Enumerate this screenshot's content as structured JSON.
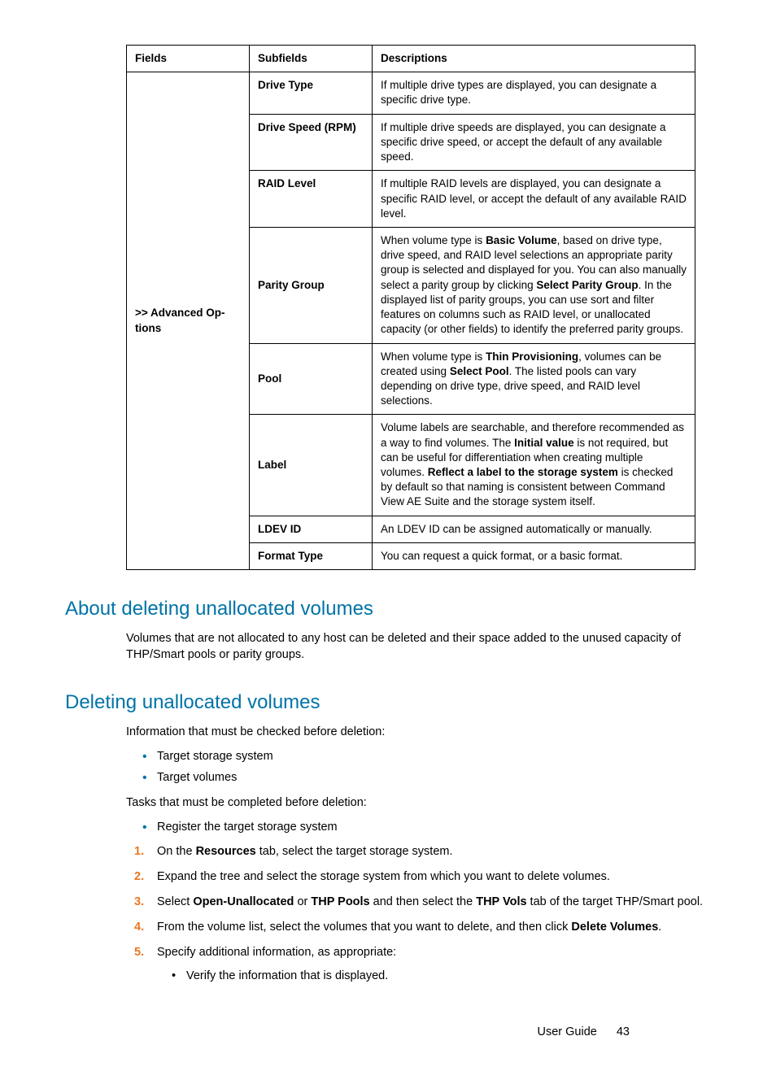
{
  "table": {
    "headers": {
      "c1": "Fields",
      "c2": "Subfields",
      "c3": "Descriptions"
    },
    "fieldLabel": ">> Advanced Op­tions",
    "rows": [
      {
        "sub": "Drive Type",
        "desc": "If multiple drive types are displayed, you can designate a specific drive type."
      },
      {
        "sub": "Drive Speed (RPM)",
        "desc": "If multiple drive speeds are displayed, you can designate a specific drive speed, or accept the default of any available speed."
      },
      {
        "sub": "RAID Level",
        "desc": "If multiple RAID levels are displayed, you can designate a specific RAID level, or accept the default of any available RAID level."
      },
      {
        "sub": "Parity Group",
        "desc_parts": {
          "a": "When volume type is ",
          "b": "Basic Volume",
          "c": ", based on drive type, drive speed, and RAID level selections an appropriate parity group is selected and displayed for you. You can also manually select a parity group by clicking ",
          "d": "Select Parity Group",
          "e": ". In the displayed list of parity groups, you can use sort and filter features on columns such as RAID level, or unallocated capacity (or other fields) to identify the preferred parity groups."
        }
      },
      {
        "sub": "Pool",
        "desc_parts": {
          "a": "When volume type is ",
          "b": "Thin Provisioning",
          "c": ", volumes can be created using ",
          "d": "Select Pool",
          "e": ". The listed pools can vary depending on drive type, drive speed, and RAID level selections."
        }
      },
      {
        "sub": "Label",
        "desc_parts": {
          "a": "Volume labels are searchable, and therefore recommended as a way to find volumes. The ",
          "b": "Initial value",
          "c": " is not required, but can be useful for differentiation when creating multiple volumes. ",
          "d": "Reflect a label to the storage system",
          "e": " is checked by default so that naming is consistent between Command View AE Suite and the storage system itself."
        }
      },
      {
        "sub": "LDEV ID",
        "desc": "An LDEV ID can be assigned automatically or manually."
      },
      {
        "sub": "Format Type",
        "desc": "You can request a quick format, or a basic format."
      }
    ]
  },
  "sections": {
    "about": {
      "heading": "About deleting unallocated volumes",
      "para": "Volumes that are not allocated to any host can be deleted and their space added to the unused capacity of THP/Smart pools or parity groups."
    },
    "deleting": {
      "heading": "Deleting unallocated volumes",
      "p1": "Information that must be checked before deletion:",
      "bullets1": [
        "Target storage system",
        "Target volumes"
      ],
      "p2": "Tasks that must be completed before deletion:",
      "bullets2": [
        "Register the target storage system"
      ],
      "steps": [
        {
          "parts": {
            "a": "On the ",
            "b": "Resources",
            "c": " tab, select the target storage system."
          }
        },
        {
          "text": "Expand the tree and select the storage system from which you want to delete volumes."
        },
        {
          "parts": {
            "a": "Select ",
            "b": "Open-Unallocated",
            "c": " or ",
            "d": "THP Pools",
            "e": " and then select the ",
            "f": "THP Vols",
            "g": " tab of the target THP/Smart pool."
          }
        },
        {
          "parts": {
            "a": "From the volume list, select the volumes that you want to delete, and then click ",
            "b": "Delete Volumes",
            "c": "."
          }
        },
        {
          "text": "Specify additional information, as appropriate:",
          "sub": [
            "Verify the information that is displayed."
          ]
        }
      ]
    }
  },
  "footer": {
    "label": "User Guide",
    "page": "43"
  }
}
